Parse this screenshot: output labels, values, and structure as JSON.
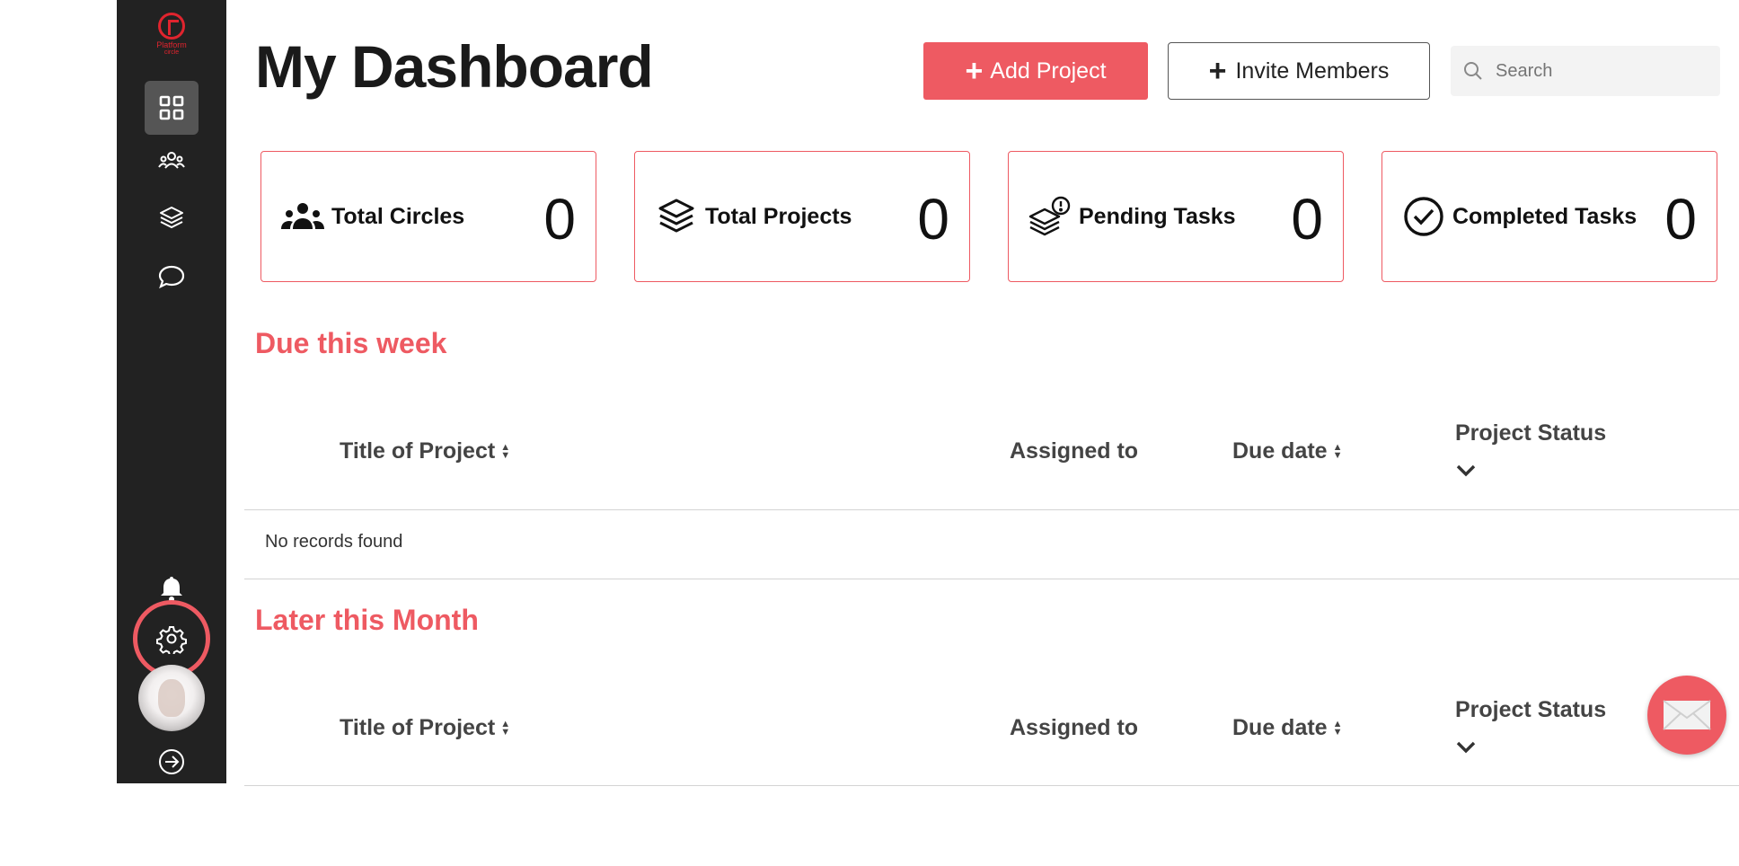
{
  "app": {
    "logo": {
      "brand": "Platform",
      "sub": "circle"
    }
  },
  "sidebar": {
    "items": [
      {
        "name": "dashboard",
        "icon": "grid-icon",
        "active": true
      },
      {
        "name": "circles",
        "icon": "people-group-icon"
      },
      {
        "name": "projects",
        "icon": "layers-icon"
      },
      {
        "name": "messages",
        "icon": "chat-bubble-icon"
      },
      {
        "name": "notifications",
        "icon": "bell-icon"
      },
      {
        "name": "settings",
        "icon": "gear-icon",
        "highlighted": true
      },
      {
        "name": "profile",
        "icon": "avatar"
      },
      {
        "name": "logout",
        "icon": "arrow-right-circle-icon"
      }
    ]
  },
  "header": {
    "title": "My Dashboard",
    "add_project_label": "Add Project",
    "invite_members_label": "Invite Members",
    "search_placeholder": "Search"
  },
  "stats": [
    {
      "label": "Total Circles",
      "value": "0",
      "icon": "people-group-icon"
    },
    {
      "label": "Total Projects",
      "value": "0",
      "icon": "layers-icon"
    },
    {
      "label": "Pending Tasks",
      "value": "0",
      "icon": "pending-tasks-icon"
    },
    {
      "label": "Completed Tasks",
      "value": "0",
      "icon": "check-circle-icon"
    }
  ],
  "due_this_week": {
    "title": "Due this week",
    "columns": [
      "Title of Project",
      "Assigned to",
      "Due date",
      "Project Status"
    ],
    "empty_text": "No records found"
  },
  "later_this_month": {
    "title": "Later this Month",
    "columns": [
      "Title of Project",
      "Assigned to",
      "Due date",
      "Project Status"
    ]
  },
  "colors": {
    "accent": "#ee5a62",
    "sidebar": "#222222",
    "logo": "#e0242e"
  }
}
